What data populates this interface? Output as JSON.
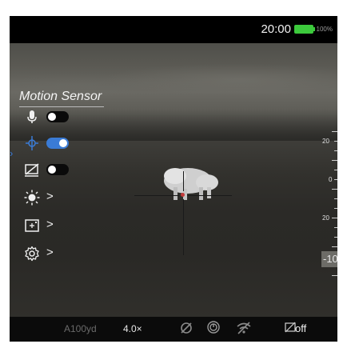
{
  "status": {
    "time": "20:00",
    "battery": "100%"
  },
  "menu": {
    "title": "Motion Sensor",
    "items": [
      {
        "icon": "microphone-icon",
        "control": "toggle",
        "state": "off"
      },
      {
        "icon": "motion-sensor-icon",
        "control": "toggle",
        "state": "on",
        "selected": true
      },
      {
        "icon": "display-off-icon",
        "control": "toggle",
        "state": "off"
      },
      {
        "icon": "brightness-icon",
        "control": "submenu"
      },
      {
        "icon": "zoom-frame-icon",
        "control": "submenu"
      },
      {
        "icon": "settings-gear-icon",
        "control": "submenu"
      }
    ]
  },
  "scale": {
    "labels": [
      "20",
      "0",
      "20"
    ],
    "highlight": "-10"
  },
  "bottom_bar": {
    "range": "A100yd",
    "zoom": "4.0×",
    "display_status": "off",
    "icons": [
      "record-off-icon",
      "power-icon",
      "wifi-off-icon",
      "display-off-icon"
    ]
  },
  "colors": {
    "accent": "#3a7bd5",
    "battery": "#3cc93c",
    "reticle_dot": "#c43a3a"
  }
}
